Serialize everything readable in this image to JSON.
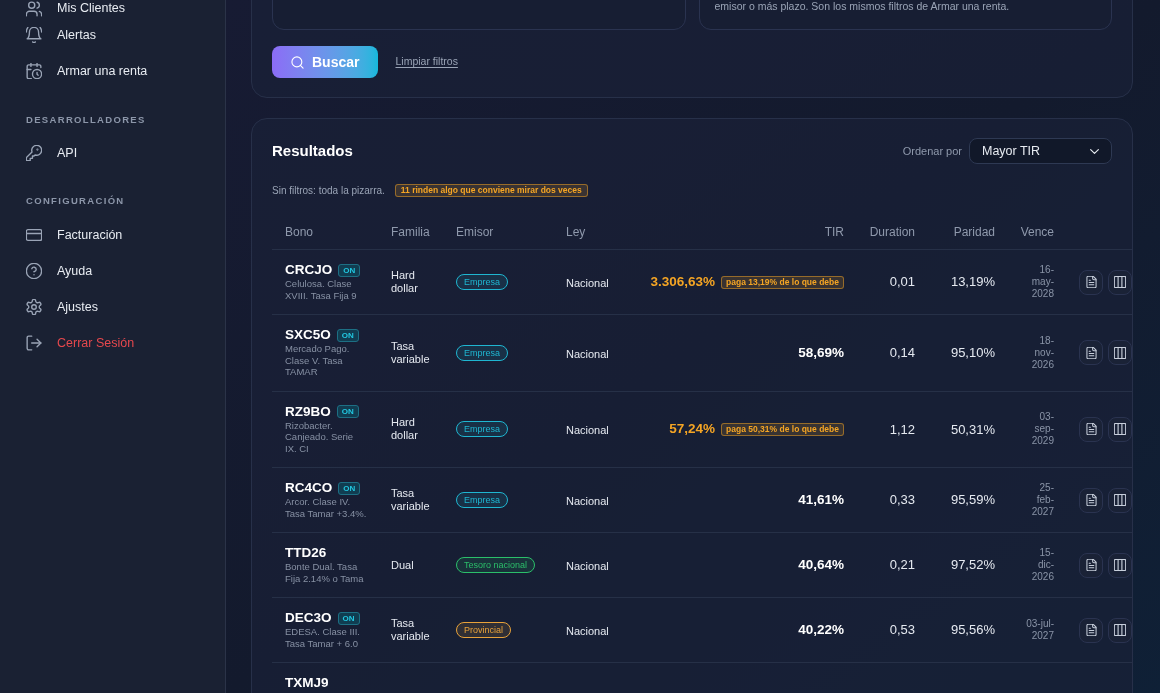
{
  "sidebar": {
    "groups": [
      {
        "items": [
          {
            "label": "Mis Clientes",
            "danger": false
          },
          {
            "label": "Alertas",
            "danger": false
          },
          {
            "label": "Armar una renta",
            "danger": false
          }
        ]
      },
      {
        "heading": "DESARROLLADORES",
        "items": [
          {
            "label": "API",
            "danger": false
          }
        ]
      },
      {
        "heading": "CONFIGURACIÓN",
        "items": [
          {
            "label": "Facturación",
            "danger": false
          },
          {
            "label": "Ayuda",
            "danger": false
          },
          {
            "label": "Ajustes",
            "danger": false
          },
          {
            "label": "Cerrar Sesión",
            "danger": true
          }
        ]
      }
    ]
  },
  "filters": {
    "note": "emisor o más plazo. Son los mismos filtros de Armar una renta.",
    "search_button": "Buscar",
    "clear_link": "Limpiar filtros"
  },
  "results": {
    "title": "Resultados",
    "sort_label": "Ordenar por",
    "sort_value": "Mayor TIR",
    "summary": "Sin filtros: toda la pizarra.",
    "alert_badge": "11 rinden algo que conviene mirar dos veces",
    "table": {
      "columns": [
        "Bono",
        "Familia",
        "Emisor",
        "Ley",
        "TIR",
        "Duration",
        "Paridad",
        "Vence"
      ],
      "rows": [
        {
          "ticker": "CRCJO",
          "tag": "ON",
          "description": "Celulosa. Clase XVIII. Tasa Fija 9",
          "familia": "Hard dollar",
          "emisor": {
            "label": "Empresa",
            "color": "#1fb6d1"
          },
          "ley": "Nacional",
          "tir": "3.306,63%",
          "tir_alert": true,
          "tir_note": "paga 13,19% de lo que debe",
          "duration": "0,01",
          "paridad": "13,19%",
          "vence": "16-may-2028"
        },
        {
          "ticker": "SXC5O",
          "tag": "ON",
          "description": "Mercado Pago. Clase V. Tasa TAMAR",
          "familia": "Tasa variable",
          "emisor": {
            "label": "Empresa",
            "color": "#1fb6d1"
          },
          "ley": "Nacional",
          "tir": "58,69%",
          "tir_alert": false,
          "duration": "0,14",
          "paridad": "95,10%",
          "vence": "18-nov-2026"
        },
        {
          "ticker": "RZ9BO",
          "tag": "ON",
          "description": "Rizobacter. Canjeado. Serie IX. CI",
          "familia": "Hard dollar",
          "emisor": {
            "label": "Empresa",
            "color": "#1fb6d1"
          },
          "ley": "Nacional",
          "tir": "57,24%",
          "tir_alert": true,
          "tir_note": "paga 50,31% de lo que debe",
          "duration": "1,12",
          "paridad": "50,31%",
          "vence": "03-sep-2029"
        },
        {
          "ticker": "RC4CO",
          "tag": "ON",
          "description": "Arcor. Clase IV. Tasa Tamar +3.4%.",
          "familia": "Tasa variable",
          "emisor": {
            "label": "Empresa",
            "color": "#1fb6d1"
          },
          "ley": "Nacional",
          "tir": "41,61%",
          "tir_alert": false,
          "duration": "0,33",
          "paridad": "95,59%",
          "vence": "25-feb-2027"
        },
        {
          "ticker": "TTD26",
          "description": "Bonte Dual. Tasa Fija 2.14% o Tama",
          "familia": "Dual",
          "emisor": {
            "label": "Tesoro nacional",
            "color": "#2bbf6a"
          },
          "ley": "Nacional",
          "tir": "40,64%",
          "tir_alert": false,
          "duration": "0,21",
          "paridad": "97,52%",
          "vence": "15-dic-2026"
        },
        {
          "ticker": "DEC3O",
          "tag": "ON",
          "description": "EDESA. Clase III. Tasa Tamar + 6.0",
          "familia": "Tasa variable",
          "emisor": {
            "label": "Provincial",
            "color": "#e8a23a"
          },
          "ley": "Nacional",
          "tir": "40,22%",
          "tir_alert": false,
          "duration": "0,53",
          "paridad": "95,56%",
          "vence": "03-jul-2027"
        },
        {
          "ticker": "TXMJ9"
        }
      ]
    }
  }
}
